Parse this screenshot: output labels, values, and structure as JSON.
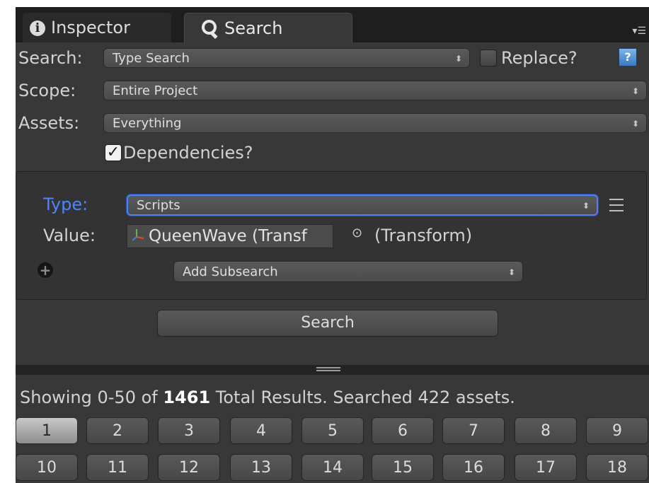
{
  "tabs": [
    {
      "label": "Inspector",
      "icon": "info-icon"
    },
    {
      "label": "Search",
      "icon": "search-icon"
    }
  ],
  "form": {
    "search_label": "Search:",
    "search_value": "Type Search",
    "replace_label": "Replace?",
    "replace_checked": false,
    "help_glyph": "?",
    "scope_label": "Scope:",
    "scope_value": "Entire Project",
    "assets_label": "Assets:",
    "assets_value": "Everything",
    "dependencies_label": "Dependencies?",
    "dependencies_checked": true
  },
  "subsearch": {
    "type_label": "Type:",
    "type_value": "Scripts",
    "value_label": "Value:",
    "value_object": "QueenWave (Transf",
    "value_type": "(Transform)",
    "add_label": "Add Subsearch"
  },
  "search_button": "Search",
  "status": {
    "prefix": "Showing 0-50 of ",
    "total": "1461",
    "suffix": " Total Results. Searched 422 assets."
  },
  "pagination": {
    "pages": [
      "1",
      "2",
      "3",
      "4",
      "5",
      "6",
      "7",
      "8",
      "9",
      "10",
      "11",
      "12",
      "13",
      "14",
      "15",
      "16",
      "17",
      "18"
    ],
    "current": "1"
  },
  "colors": {
    "panel_bg": "#383838",
    "accent_blue": "#4f7ff0",
    "type_label_blue": "#4a86ff"
  }
}
